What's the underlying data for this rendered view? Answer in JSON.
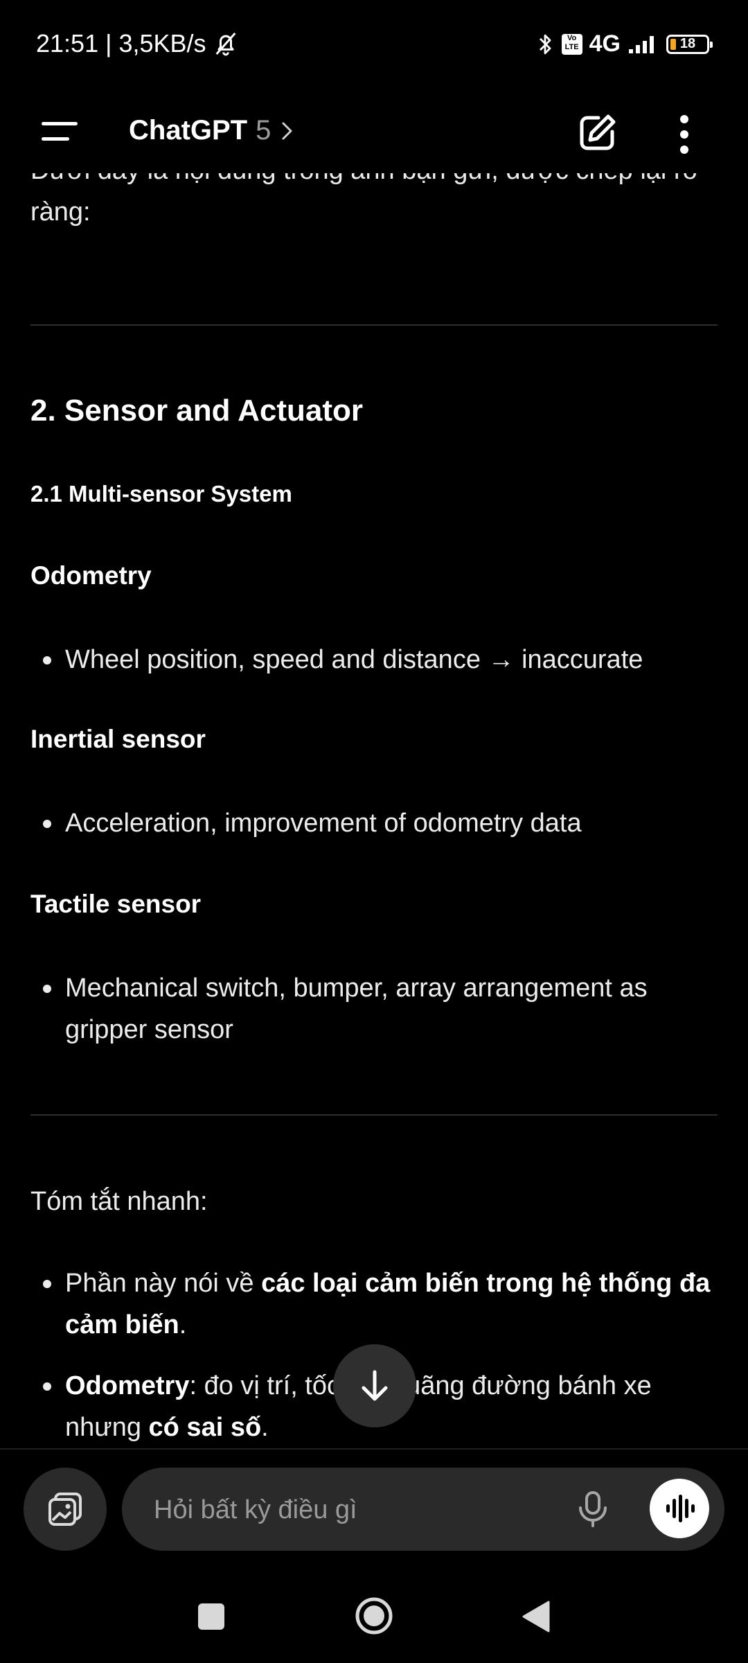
{
  "status_bar": {
    "time_speed": "21:51 | 3,5KB/s",
    "network": "4G",
    "volte": "Vo LTE",
    "battery": "18"
  },
  "app_bar": {
    "title": "ChatGPT",
    "version": "5"
  },
  "content": {
    "intro": "Dưới đây là nội dung trong ảnh bạn gửi, được chép lại rõ ràng:",
    "section_title": "2. Sensor and Actuator",
    "subsection_title": "2.1 Multi-sensor System",
    "odometry_heading": "Odometry",
    "odometry_bullet": "Wheel position, speed and distance → inaccurate",
    "inertial_heading": "Inertial sensor",
    "inertial_bullet": "Acceleration, improvement of odometry data",
    "tactile_heading": "Tactile sensor",
    "tactile_bullet": "Mechanical switch, bumper, array arrangement as gripper sensor",
    "summary_label": "Tóm tắt nhanh:",
    "summary_bullets": [
      {
        "prefix": "Phần này nói về ",
        "bold": "các loại cảm biến trong hệ thống đa cảm biến",
        "suffix": "."
      },
      {
        "bold": "Odometry",
        "middle": ": đo vị trí, tốc độ, quãng đường bánh xe nhưng ",
        "bold2": "có sai số",
        "suffix": "."
      }
    ]
  },
  "composer": {
    "placeholder": "Hỏi bất kỳ điều gì"
  }
}
